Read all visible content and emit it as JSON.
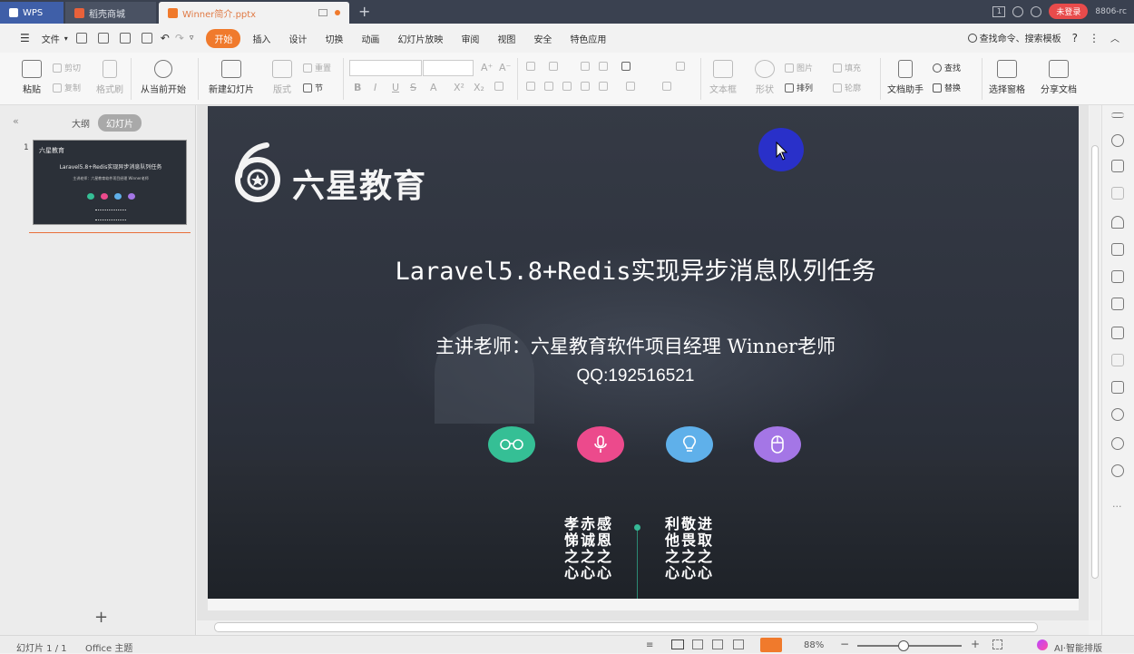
{
  "titlebar": {
    "wps_tab": "WPS",
    "daoke_tab": "稻壳商城",
    "doc_tab": "Winner简介.pptx",
    "login_button": "未登录",
    "user_id": "8806-rc",
    "page_badge": "1",
    "colors": {
      "bar": "#3a4150",
      "wps": "#3f5fa8",
      "login": "#e84b4b"
    }
  },
  "menubar": {
    "file": "文件",
    "tabs": [
      "开始",
      "插入",
      "设计",
      "切换",
      "动画",
      "幻灯片放映",
      "审阅",
      "视图",
      "安全",
      "特色应用"
    ],
    "active_tab": "开始",
    "search": "查找命令、搜索模板",
    "help": "?",
    "accent": "#f07a2c"
  },
  "ribbon": {
    "paste": "粘贴",
    "cut": "剪切",
    "copy": "复制",
    "format_painter": "格式刷",
    "play_from_current": "从当前开始",
    "new_slide": "新建幻灯片",
    "layout": "版式",
    "reset": "重置",
    "section": "节",
    "textbox": "文本框",
    "shapes": "形状",
    "picture": "图片",
    "fill": "填充",
    "arrange": "排列",
    "outline": "轮廓",
    "doc_assistant": "文档助手",
    "find": "查找",
    "replace": "替换",
    "select_pane": "选择窗格",
    "share_doc": "分享文档"
  },
  "leftpanel": {
    "outline_tab": "大纲",
    "slides_tab": "幻灯片",
    "thumb_number": "1",
    "collapse": "«",
    "add_slide": "+"
  },
  "slide": {
    "logo_text": "六星教育",
    "title": "Laravel5.8+Redis实现异步消息队列任务",
    "teacher": "主讲老师：六星教育软件项目经理  Winner老师",
    "qq": "QQ:192516521",
    "circles": [
      {
        "icon": "glasses-icon",
        "color": "#35bf95"
      },
      {
        "icon": "microphone-icon",
        "color": "#ec4a8c"
      },
      {
        "icon": "lightbulb-icon",
        "color": "#5fb0ea"
      },
      {
        "icon": "mouse-icon",
        "color": "#a476e6"
      }
    ],
    "motto_left": [
      [
        "孝",
        "赤",
        "感"
      ],
      [
        "悌",
        "诚",
        "恩"
      ],
      [
        "之",
        "之",
        "之"
      ],
      [
        "心",
        "心",
        "心"
      ]
    ],
    "motto_right": [
      [
        "利",
        "敬",
        "进"
      ],
      [
        "他",
        "畏",
        "取"
      ],
      [
        "之",
        "之",
        "之"
      ],
      [
        "心",
        "心",
        "心"
      ]
    ]
  },
  "statusbar": {
    "slide_info": "幻灯片 1 / 1",
    "theme": "Office 主题",
    "zoom": "88%",
    "ai_layout": "AI·智能排版"
  }
}
